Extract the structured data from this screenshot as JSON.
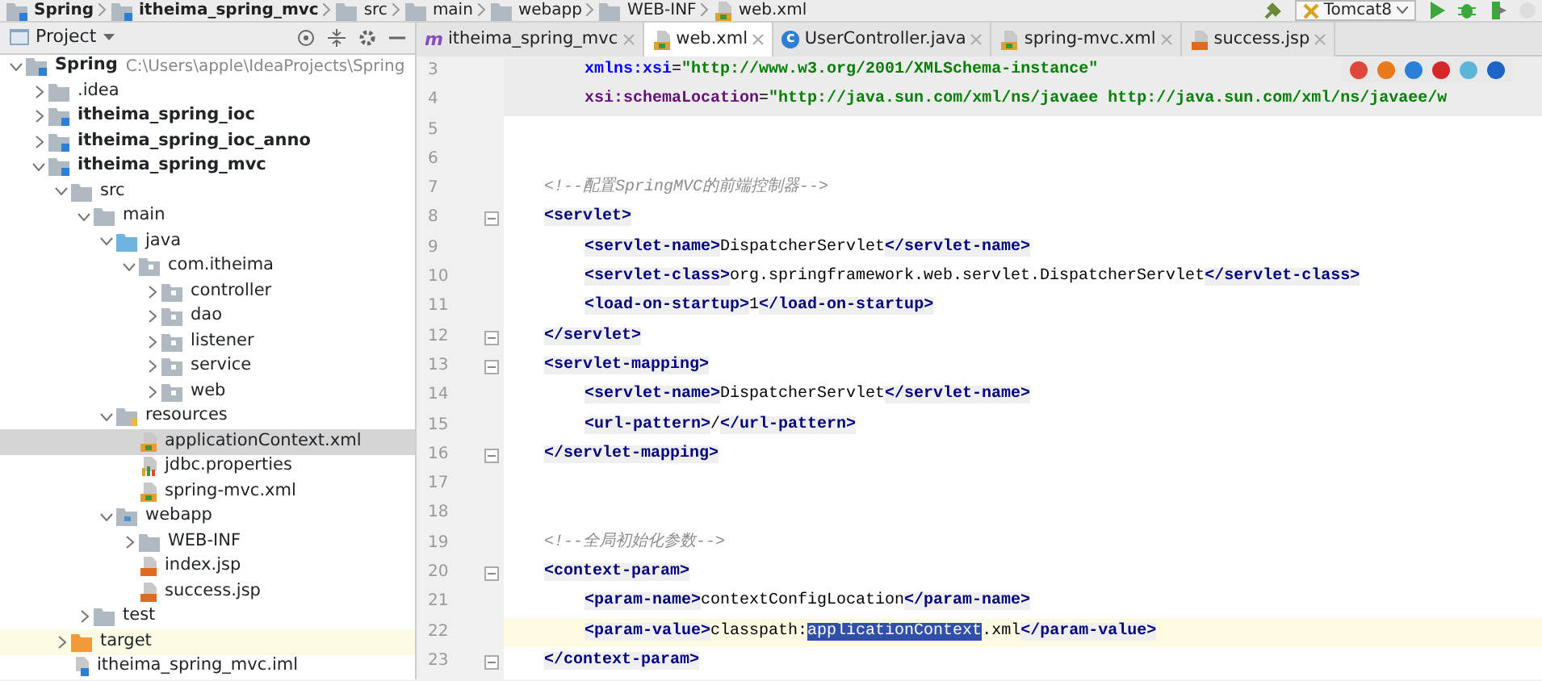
{
  "breadcrumb": [
    {
      "label": "Spring",
      "kind": "module"
    },
    {
      "label": "itheima_spring_mvc",
      "kind": "module"
    },
    {
      "label": "src",
      "kind": "folder"
    },
    {
      "label": "main",
      "kind": "folder"
    },
    {
      "label": "webapp",
      "kind": "folder"
    },
    {
      "label": "WEB-INF",
      "kind": "folder"
    },
    {
      "label": "web.xml",
      "kind": "xml"
    }
  ],
  "run_config": {
    "label": "Tomcat8"
  },
  "project_panel": {
    "title": "Project",
    "tree": [
      {
        "label": "Spring",
        "path": "C:\\Users\\apple\\IdeaProjects\\Spring",
        "kind": "module",
        "expanded": true,
        "selected": false,
        "children": [
          {
            "label": ".idea",
            "kind": "folder",
            "expanded": false,
            "selected": false
          },
          {
            "label": "itheima_spring_ioc",
            "kind": "module",
            "expanded": false,
            "selected": false
          },
          {
            "label": "itheima_spring_ioc_anno",
            "kind": "module",
            "expanded": false,
            "selected": false
          },
          {
            "label": "itheima_spring_mvc",
            "kind": "module",
            "expanded": true,
            "selected": false,
            "children": [
              {
                "label": "src",
                "kind": "folder",
                "expanded": true,
                "selected": false,
                "children": [
                  {
                    "label": "main",
                    "kind": "folder",
                    "expanded": true,
                    "selected": false,
                    "children": [
                      {
                        "label": "java",
                        "kind": "source",
                        "expanded": true,
                        "selected": false,
                        "children": [
                          {
                            "label": "com.itheima",
                            "kind": "package",
                            "expanded": true,
                            "selected": false,
                            "children": [
                              {
                                "label": "controller",
                                "kind": "package",
                                "expanded": false,
                                "selected": false
                              },
                              {
                                "label": "dao",
                                "kind": "package",
                                "expanded": false,
                                "selected": false
                              },
                              {
                                "label": "listener",
                                "kind": "package",
                                "expanded": false,
                                "selected": false
                              },
                              {
                                "label": "service",
                                "kind": "package",
                                "expanded": false,
                                "selected": false
                              },
                              {
                                "label": "web",
                                "kind": "package",
                                "expanded": false,
                                "selected": false
                              }
                            ]
                          }
                        ]
                      },
                      {
                        "label": "resources",
                        "kind": "resources",
                        "expanded": true,
                        "selected": false,
                        "children": [
                          {
                            "label": "applicationContext.xml",
                            "kind": "xml",
                            "selected": true
                          },
                          {
                            "label": "jdbc.properties",
                            "kind": "properties",
                            "selected": false
                          },
                          {
                            "label": "spring-mvc.xml",
                            "kind": "xml",
                            "selected": false
                          }
                        ]
                      },
                      {
                        "label": "webapp",
                        "kind": "web",
                        "expanded": true,
                        "selected": false,
                        "children": [
                          {
                            "label": "WEB-INF",
                            "kind": "folder",
                            "expanded": false,
                            "selected": false
                          },
                          {
                            "label": "index.jsp",
                            "kind": "jsp",
                            "selected": false
                          },
                          {
                            "label": "success.jsp",
                            "kind": "jsp",
                            "selected": false
                          }
                        ]
                      }
                    ]
                  },
                  {
                    "label": "test",
                    "kind": "folder",
                    "expanded": false,
                    "selected": false
                  }
                ]
              },
              {
                "label": "target",
                "kind": "excluded",
                "expanded": false,
                "selected": false
              },
              {
                "label": "itheima_spring_mvc.iml",
                "kind": "iml",
                "selected": false
              }
            ]
          }
        ]
      }
    ]
  },
  "tabs": [
    {
      "label": "itheima_spring_mvc",
      "badge": "m",
      "kind": "module",
      "selected": false
    },
    {
      "label": "web.xml",
      "kind": "xml",
      "selected": true
    },
    {
      "label": "UserController.java",
      "badge": "c",
      "kind": "class",
      "selected": false
    },
    {
      "label": "spring-mvc.xml",
      "kind": "xml",
      "selected": false
    },
    {
      "label": "success.jsp",
      "kind": "jsp",
      "selected": false
    }
  ],
  "editor": {
    "lines": [
      {
        "number": "3",
        "fold": false,
        "nested": true,
        "shaded": true,
        "current": false,
        "segments": [
          {
            "kind": "ns",
            "text": "xmlns:xsi"
          },
          {
            "kind": "text",
            "text": "="
          },
          {
            "kind": "string",
            "text": "\"http://www.w3.org/2001/XMLSchema-instance\""
          }
        ]
      },
      {
        "number": "4",
        "fold": false,
        "nested": true,
        "shaded": true,
        "current": false,
        "segments": [
          {
            "kind": "attr",
            "text": "xsi:schemaLocation"
          },
          {
            "kind": "text",
            "text": "="
          },
          {
            "kind": "string",
            "text": "\"http://java.sun.com/xml/ns/javaee http://java.sun.com/xml/ns/javaee/w"
          }
        ]
      },
      {
        "number": "5",
        "fold": false
      },
      {
        "number": "6",
        "fold": false
      },
      {
        "number": "7",
        "fold": false,
        "nested": false,
        "shaded": false,
        "current": false,
        "segments": [
          {
            "kind": "comment",
            "text": "<!--配置SpringMVC的前端控制器-->"
          }
        ]
      },
      {
        "number": "8",
        "fold": true,
        "nested": false,
        "shaded": false,
        "current": false,
        "segments": [
          {
            "kind": "tag",
            "text": "<servlet>"
          }
        ]
      },
      {
        "number": "9",
        "fold": false,
        "nested": true,
        "shaded": false,
        "current": false,
        "segments": [
          {
            "kind": "tag",
            "text": "<servlet-name>"
          },
          {
            "kind": "text",
            "text": "DispatcherServlet"
          },
          {
            "kind": "tag",
            "text": "</servlet-name>"
          }
        ]
      },
      {
        "number": "10",
        "fold": false,
        "nested": true,
        "shaded": false,
        "current": false,
        "segments": [
          {
            "kind": "tag",
            "text": "<servlet-class>"
          },
          {
            "kind": "text",
            "text": "org.springframework.web.servlet.DispatcherServlet"
          },
          {
            "kind": "tag",
            "text": "</servlet-class>"
          }
        ]
      },
      {
        "number": "11",
        "fold": false,
        "nested": true,
        "shaded": false,
        "current": false,
        "segments": [
          {
            "kind": "tag",
            "text": "<load-on-startup>"
          },
          {
            "kind": "text",
            "text": "1"
          },
          {
            "kind": "tag",
            "text": "</load-on-startup>"
          }
        ]
      },
      {
        "number": "12",
        "fold": true,
        "nested": false,
        "shaded": false,
        "current": false,
        "segments": [
          {
            "kind": "tag",
            "text": "</servlet>"
          }
        ]
      },
      {
        "number": "13",
        "fold": true,
        "nested": false,
        "shaded": false,
        "current": false,
        "segments": [
          {
            "kind": "tag",
            "text": "<servlet-mapping>"
          }
        ]
      },
      {
        "number": "14",
        "fold": false,
        "nested": true,
        "shaded": false,
        "current": false,
        "segments": [
          {
            "kind": "tag",
            "text": "<servlet-name>"
          },
          {
            "kind": "text",
            "text": "DispatcherServlet"
          },
          {
            "kind": "tag",
            "text": "</servlet-name>"
          }
        ]
      },
      {
        "number": "15",
        "fold": false,
        "nested": true,
        "shaded": false,
        "current": false,
        "segments": [
          {
            "kind": "tag",
            "text": "<url-pattern>"
          },
          {
            "kind": "text",
            "text": "/"
          },
          {
            "kind": "tag",
            "text": "</url-pattern>"
          }
        ]
      },
      {
        "number": "16",
        "fold": true,
        "nested": false,
        "shaded": false,
        "current": false,
        "segments": [
          {
            "kind": "tag",
            "text": "</servlet-mapping>"
          }
        ]
      },
      {
        "number": "17",
        "fold": false
      },
      {
        "number": "18",
        "fold": false
      },
      {
        "number": "19",
        "fold": false,
        "nested": false,
        "shaded": false,
        "current": false,
        "segments": [
          {
            "kind": "comment",
            "text": "<!--全局初始化参数-->"
          }
        ]
      },
      {
        "number": "20",
        "fold": true,
        "nested": false,
        "shaded": false,
        "current": false,
        "segments": [
          {
            "kind": "tag",
            "text": "<context-param>"
          }
        ]
      },
      {
        "number": "21",
        "fold": false,
        "nested": true,
        "shaded": false,
        "current": false,
        "segments": [
          {
            "kind": "tag",
            "text": "<param-name>"
          },
          {
            "kind": "text",
            "text": "contextConfigLocation"
          },
          {
            "kind": "tag",
            "text": "</param-name>"
          }
        ]
      },
      {
        "number": "22",
        "fold": false,
        "nested": true,
        "shaded": false,
        "current": true,
        "segments": [
          {
            "kind": "tag",
            "text": "<param-value>"
          },
          {
            "kind": "text",
            "text": "classpath:"
          },
          {
            "kind": "selection",
            "text": "applicationContext"
          },
          {
            "kind": "text",
            "text": ".xml"
          },
          {
            "kind": "tag",
            "text": "</param-value>"
          }
        ]
      },
      {
        "number": "23",
        "fold": true,
        "nested": false,
        "shaded": false,
        "current": false,
        "segments": [
          {
            "kind": "tag",
            "text": "</context-param>"
          }
        ]
      }
    ]
  },
  "browser_popup": {
    "browsers": [
      {
        "color": "#e0463a"
      },
      {
        "color": "#e87a1e"
      },
      {
        "color": "#2a7fd6"
      },
      {
        "color": "#d6262b"
      },
      {
        "color": "#5bb5d6"
      },
      {
        "color": "#1d64c4"
      }
    ]
  }
}
